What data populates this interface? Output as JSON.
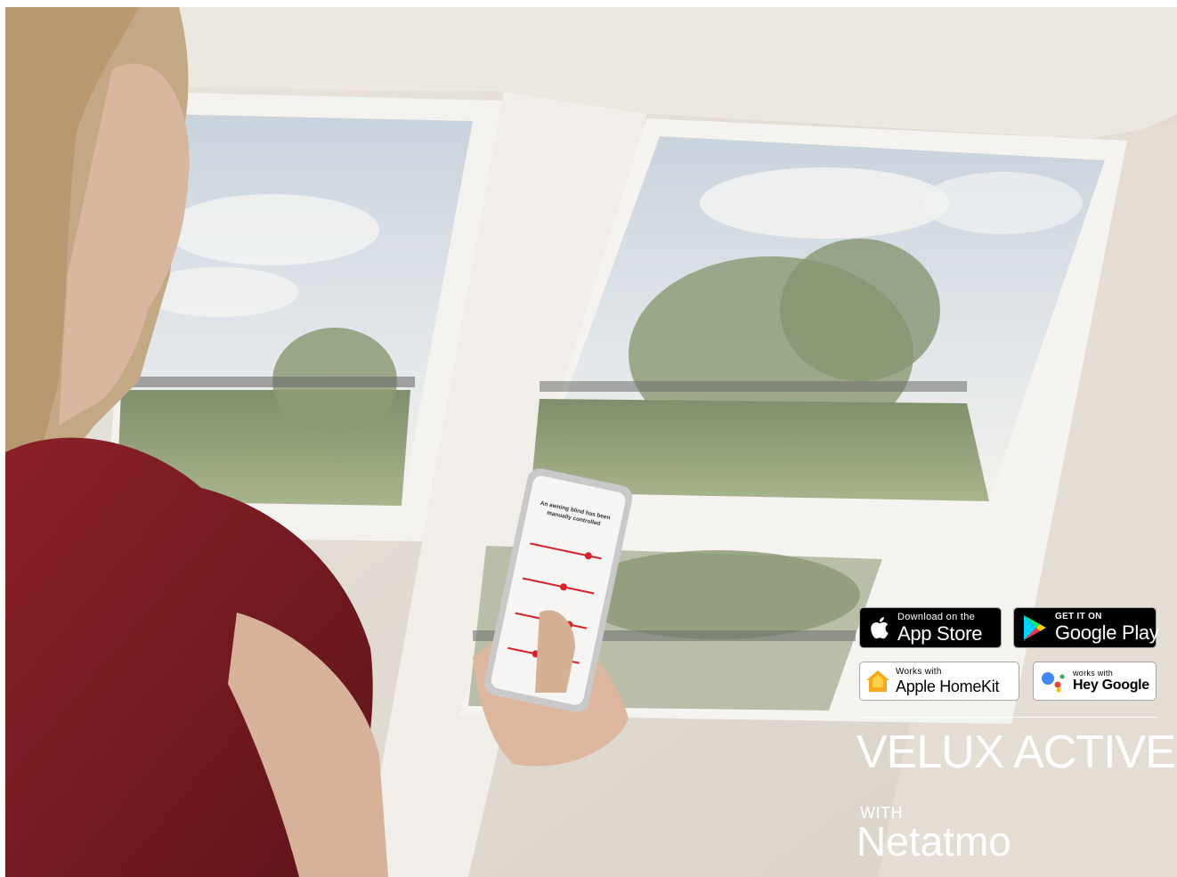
{
  "badges": {
    "app_store": {
      "line1": "Download on the",
      "line2": "App Store",
      "icon": "apple-icon"
    },
    "google_play": {
      "line1": "GET IT ON",
      "line2": "Google Play",
      "icon": "google-play-icon"
    },
    "homekit": {
      "line1": "Works with",
      "line2": "Apple HomeKit",
      "icon": "homekit-icon"
    },
    "hey_google": {
      "line1": "works with",
      "line2": "Hey Google",
      "icon": "google-assistant-icon"
    }
  },
  "brand": {
    "name": "VELUX ACTIVE",
    "with": "WITH",
    "partner": "Netatmo"
  },
  "phone_screen": {
    "headline": "An awning blind has been manually controlled"
  },
  "colors": {
    "badge_dark": "#000000",
    "badge_light": "#ffffff",
    "brand_text": "#ffffff",
    "shirt": "#7a1c22",
    "app_accent": "#d3232b"
  }
}
